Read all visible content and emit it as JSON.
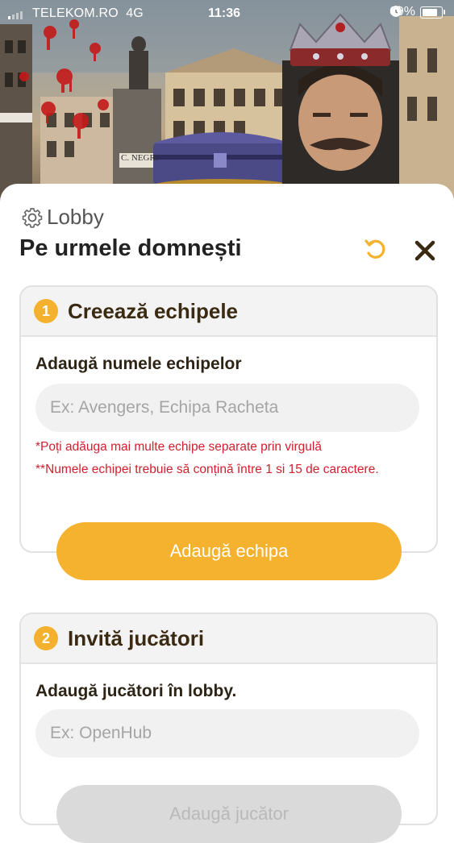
{
  "status_bar": {
    "carrier": "TELEKOM.RO",
    "network": "4G",
    "time": "11:36",
    "battery": "69%"
  },
  "header": {
    "lobby_label": "Lobby",
    "title": "Pe urmele domnești"
  },
  "teams_section": {
    "step_number": "1",
    "title": "Creează echipele",
    "field_label": "Adaugă numele echipelor",
    "input_placeholder": "Ex: Avengers, Echipa Racheta",
    "hint_1": "*Poți adăuga mai multe echipe separate prin virgulă",
    "hint_2": "**Numele echipei trebuie să conțină între 1 si 15 de caractere.",
    "button_label": "Adaugă echipa"
  },
  "players_section": {
    "step_number": "2",
    "title": "Invită jucători",
    "field_label": "Adaugă jucători în lobby.",
    "input_placeholder": "Ex: OpenHub",
    "button_label": "Adaugă jucător"
  },
  "hero": {
    "sign_text": "C. NEGRI"
  },
  "colors": {
    "accent": "#f4b22f",
    "hint": "#d0202f",
    "title": "#222222"
  }
}
